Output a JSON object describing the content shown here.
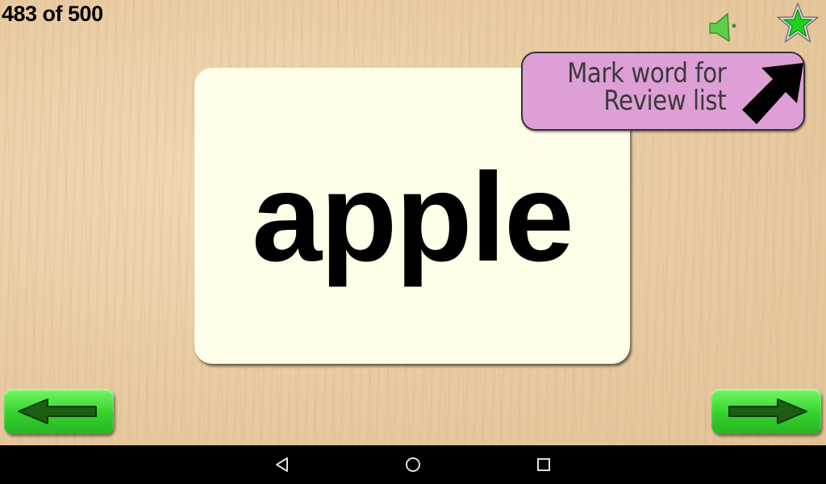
{
  "header": {
    "progress_text": "483 of 500"
  },
  "toolbar": {
    "speaker_icon": "speaker-icon",
    "star_icon": "star-icon",
    "speaker_color": "#5fcf4a",
    "star_color": "#1fd11b"
  },
  "card": {
    "word": "apple",
    "background_color": "#fefee9"
  },
  "tooltip": {
    "line1": "Mark word for",
    "line2": "Review list",
    "background_color": "#dd9fd6",
    "arrow_icon": "arrow-up-right-icon"
  },
  "navigation": {
    "prev_icon": "arrow-left-icon",
    "next_icon": "arrow-right-icon",
    "button_color": "#3fd935"
  },
  "system_bar": {
    "back_icon": "back-triangle-icon",
    "home_icon": "home-circle-icon",
    "recents_icon": "recents-square-icon"
  }
}
